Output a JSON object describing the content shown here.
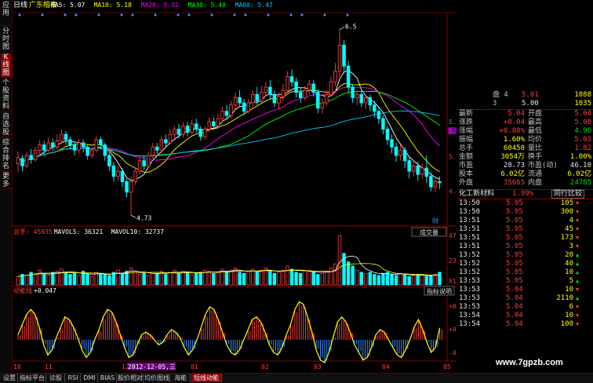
{
  "sidetabs": [
    "应用",
    "分时图",
    "K线图",
    "个股资料",
    "自选股",
    "综合排名",
    "更多"
  ],
  "header": {
    "period": "日线",
    "stock": "广东榕泰",
    "ma": [
      {
        "label": "MA5: 5.07",
        "color": "#ffffff"
      },
      {
        "label": "MA10: 5.18",
        "color": "#ffff00"
      },
      {
        "label": "MA20: 5.32",
        "color": "#ff00ff"
      },
      {
        "label": "MA30: 5.40",
        "color": "#00ff00"
      },
      {
        "label": "MA60: 5.47",
        "color": "#00c8ff"
      }
    ]
  },
  "price_axis": [
    "5.62",
    "5.53",
    "5.29",
    "4.96"
  ],
  "price_marks": {
    "high": "6.5",
    "low": "4.73"
  },
  "vol_header": {
    "items": [
      {
        "label": "总手: 45935",
        "color": "#ff3c3c"
      },
      {
        "label": "MAVOL5: 36321",
        "color": "#ffffff"
      },
      {
        "label": "MAVOL10: 32737",
        "color": "#ffffff"
      }
    ],
    "select": "成交量",
    "fin_icon": "财"
  },
  "vol_axis": [
    "47368",
    "23684",
    "X10"
  ],
  "ind_header": {
    "name": "动能线",
    "value": "+0.047",
    "button": "指标说明"
  },
  "ind_axis": [
    "+0.133",
    "+0.041",
    "-0.051"
  ],
  "x_axis": [
    "10",
    "11",
    "12",
    "2012-12-05,三",
    "01",
    "02",
    "03",
    "04",
    "05"
  ],
  "chart_data": {
    "type": "candlestick",
    "price_range": [
      4.73,
      6.5
    ],
    "candles": [
      [
        5.22,
        5.28,
        5.34,
        5.14
      ],
      [
        5.27,
        5.2,
        5.3,
        5.15
      ],
      [
        5.2,
        5.3,
        5.33,
        5.18
      ],
      [
        5.3,
        5.26,
        5.36,
        5.22
      ],
      [
        5.26,
        5.35,
        5.38,
        5.24
      ],
      [
        5.35,
        5.4,
        5.45,
        5.31
      ],
      [
        5.4,
        5.35,
        5.44,
        5.3
      ],
      [
        5.35,
        5.42,
        5.47,
        5.33
      ],
      [
        5.42,
        5.38,
        5.46,
        5.34
      ],
      [
        5.38,
        5.44,
        5.5,
        5.35
      ],
      [
        5.44,
        5.5,
        5.55,
        5.41
      ],
      [
        5.5,
        5.45,
        5.53,
        5.4
      ],
      [
        5.45,
        5.4,
        5.48,
        5.36
      ],
      [
        5.4,
        5.35,
        5.43,
        5.3
      ],
      [
        5.35,
        5.42,
        5.46,
        5.32
      ],
      [
        5.42,
        5.38,
        5.45,
        5.33
      ],
      [
        5.38,
        5.3,
        5.4,
        5.26
      ],
      [
        5.3,
        5.35,
        5.38,
        5.27
      ],
      [
        5.35,
        5.45,
        5.48,
        5.33
      ],
      [
        5.45,
        5.4,
        5.48,
        5.36
      ],
      [
        5.4,
        5.3,
        5.42,
        5.25
      ],
      [
        5.3,
        5.2,
        5.33,
        5.15
      ],
      [
        5.2,
        5.1,
        5.24,
        5.05
      ],
      [
        5.1,
        5.15,
        5.2,
        5.06
      ],
      [
        5.15,
        5.05,
        5.18,
        5.0
      ],
      [
        5.05,
        4.95,
        5.08,
        4.9
      ],
      [
        4.95,
        5.05,
        5.1,
        4.73
      ],
      [
        5.05,
        5.15,
        5.18,
        5.02
      ],
      [
        5.15,
        5.25,
        5.28,
        5.12
      ],
      [
        5.25,
        5.2,
        5.3,
        5.16
      ],
      [
        5.2,
        5.3,
        5.33,
        5.18
      ],
      [
        5.3,
        5.38,
        5.42,
        5.27
      ],
      [
        5.38,
        5.35,
        5.42,
        5.31
      ],
      [
        5.35,
        5.45,
        5.48,
        5.33
      ],
      [
        5.45,
        5.42,
        5.5,
        5.38
      ],
      [
        5.42,
        5.5,
        5.55,
        5.4
      ],
      [
        5.5,
        5.55,
        5.58,
        5.46
      ],
      [
        5.55,
        5.5,
        5.6,
        5.46
      ],
      [
        5.5,
        5.58,
        5.62,
        5.47
      ],
      [
        5.58,
        5.52,
        5.62,
        5.48
      ],
      [
        5.52,
        5.6,
        5.64,
        5.5
      ],
      [
        5.6,
        5.55,
        5.65,
        5.51
      ],
      [
        5.55,
        5.48,
        5.58,
        5.44
      ],
      [
        5.48,
        5.55,
        5.58,
        5.45
      ],
      [
        5.55,
        5.62,
        5.66,
        5.52
      ],
      [
        5.62,
        5.58,
        5.66,
        5.54
      ],
      [
        5.58,
        5.65,
        5.7,
        5.56
      ],
      [
        5.65,
        5.72,
        5.76,
        5.62
      ],
      [
        5.72,
        5.68,
        5.78,
        5.64
      ],
      [
        5.68,
        5.78,
        5.82,
        5.65
      ],
      [
        5.78,
        5.85,
        5.9,
        5.74
      ],
      [
        5.85,
        5.8,
        5.92,
        5.76
      ],
      [
        5.8,
        5.72,
        5.84,
        5.68
      ],
      [
        5.72,
        5.8,
        5.84,
        5.7
      ],
      [
        5.8,
        5.88,
        5.92,
        5.76
      ],
      [
        5.88,
        5.82,
        5.95,
        5.78
      ],
      [
        5.82,
        5.9,
        5.96,
        5.8
      ],
      [
        5.9,
        5.95,
        6.0,
        5.86
      ],
      [
        5.95,
        5.88,
        6.02,
        5.84
      ],
      [
        5.88,
        5.8,
        5.92,
        5.76
      ],
      [
        5.8,
        5.86,
        5.9,
        5.74
      ],
      [
        5.86,
        5.92,
        5.98,
        5.82
      ],
      [
        5.92,
        6.05,
        6.1,
        5.9
      ],
      [
        6.05,
        6.0,
        6.12,
        5.95
      ],
      [
        6.0,
        5.9,
        6.04,
        5.85
      ],
      [
        5.9,
        5.85,
        5.95,
        5.8
      ],
      [
        5.85,
        5.92,
        5.96,
        5.82
      ],
      [
        5.92,
        5.98,
        6.02,
        5.88
      ],
      [
        5.98,
        5.9,
        6.02,
        5.86
      ],
      [
        5.9,
        5.75,
        5.93,
        5.7
      ],
      [
        5.75,
        5.8,
        5.84,
        5.7
      ],
      [
        5.8,
        5.88,
        5.92,
        5.77
      ],
      [
        5.88,
        6.0,
        6.05,
        5.86
      ],
      [
        6.0,
        6.1,
        6.18,
        5.96
      ],
      [
        6.1,
        6.35,
        6.5,
        6.05
      ],
      [
        6.35,
        6.15,
        6.4,
        6.08
      ],
      [
        6.15,
        5.95,
        6.2,
        5.9
      ],
      [
        5.95,
        5.85,
        5.98,
        5.8
      ],
      [
        5.85,
        5.88,
        5.92,
        5.78
      ],
      [
        5.88,
        5.8,
        5.92,
        5.76
      ],
      [
        5.8,
        5.85,
        5.88,
        5.74
      ],
      [
        5.85,
        5.78,
        5.88,
        5.72
      ],
      [
        5.78,
        5.72,
        5.82,
        5.66
      ],
      [
        5.72,
        5.65,
        5.75,
        5.6
      ],
      [
        5.65,
        5.55,
        5.68,
        5.5
      ],
      [
        5.55,
        5.45,
        5.58,
        5.4
      ],
      [
        5.45,
        5.38,
        5.5,
        5.32
      ],
      [
        5.38,
        5.3,
        5.42,
        5.24
      ],
      [
        5.3,
        5.35,
        5.4,
        5.25
      ],
      [
        5.35,
        5.25,
        5.38,
        5.18
      ],
      [
        5.25,
        5.15,
        5.28,
        5.08
      ],
      [
        5.15,
        5.2,
        5.26,
        5.1
      ],
      [
        5.2,
        5.12,
        5.24,
        5.06
      ],
      [
        5.12,
        5.18,
        5.22,
        5.08
      ],
      [
        5.18,
        5.1,
        5.3,
        5.04
      ],
      [
        5.1,
        5.0,
        5.14,
        4.96
      ],
      [
        5.0,
        5.05,
        5.08,
        4.95
      ],
      [
        5.05,
        5.04,
        5.1,
        4.98
      ]
    ],
    "ma5_last": 5.07,
    "ma10_last": 5.18,
    "ma20_last": 5.32,
    "ma30_last": 5.4,
    "ma60_last": 5.47,
    "volume_range": [
      0,
      47368
    ],
    "volumes": [
      8,
      10,
      9,
      12,
      11,
      14,
      10,
      9,
      12,
      13,
      15,
      12,
      10,
      11,
      9,
      13,
      10,
      8,
      12,
      11,
      10,
      9,
      12,
      14,
      11,
      13,
      16,
      12,
      10,
      11,
      9,
      12,
      11,
      13,
      10,
      12,
      14,
      11,
      13,
      12,
      10,
      11,
      12,
      14,
      13,
      11,
      12,
      15,
      13,
      14,
      16,
      12,
      11,
      13,
      15,
      12,
      14,
      16,
      13,
      11,
      12,
      14,
      18,
      15,
      12,
      11,
      13,
      14,
      12,
      10,
      11,
      13,
      16,
      20,
      47,
      30,
      22,
      18,
      14,
      12,
      11,
      12,
      10,
      9,
      11,
      12,
      10,
      9,
      11,
      10,
      8,
      9,
      10,
      9,
      8,
      9,
      10,
      12
    ],
    "indicator": {
      "name": "动能线",
      "last": 0.047,
      "range": [
        -0.09,
        0.17
      ],
      "values": [
        0.02,
        0.06,
        0.1,
        0.12,
        0.1,
        0.05,
        -0.02,
        -0.06,
        -0.04,
        0.01,
        0.05,
        0.09,
        0.08,
        0.05,
        0.01,
        -0.04,
        -0.07,
        -0.05,
        0.0,
        0.04,
        0.09,
        0.12,
        0.11,
        0.07,
        0.02,
        -0.03,
        -0.07,
        -0.06,
        -0.02,
        0.02,
        0.03,
        0.02,
        0.0,
        -0.02,
        -0.01,
        0.02,
        0.04,
        0.03,
        0.01,
        -0.03,
        -0.06,
        -0.04,
        0.0,
        0.05,
        0.1,
        0.13,
        0.12,
        0.08,
        0.03,
        -0.02,
        -0.05,
        -0.06,
        -0.04,
        0.0,
        0.04,
        0.08,
        0.09,
        0.07,
        0.03,
        -0.02,
        -0.05,
        -0.06,
        -0.03,
        0.02,
        0.06,
        0.12,
        0.15,
        0.14,
        0.09,
        0.03,
        -0.04,
        -0.08,
        -0.09,
        -0.05,
        0.01,
        0.07,
        0.09,
        0.07,
        0.03,
        -0.02,
        -0.05,
        -0.08,
        -0.07,
        -0.03,
        0.02,
        0.04,
        0.03,
        0.0,
        -0.03,
        -0.06,
        -0.07,
        -0.04,
        0.0,
        0.05,
        0.08,
        0.04,
        -0.01,
        -0.05,
        -0.03,
        0.047
      ]
    }
  },
  "quote": {
    "order_rows": [
      {
        "label": "盘 4",
        "price": "5.01",
        "vol": "1088"
      },
      {
        "label": "3",
        "price": "5.00",
        "vol": "1035"
      }
    ],
    "stats": [
      {
        "l1": "最新",
        "v1": "5.04",
        "c1": "red",
        "l2": "开盘",
        "v2": "5.04",
        "c2": "red"
      },
      {
        "l1": "涨跌",
        "v1": "+0.04",
        "c1": "red",
        "l2": "最高",
        "v2": "5.08",
        "c2": "red"
      },
      {
        "l1": "涨幅",
        "v1": "+0.80%",
        "c1": "red",
        "l2": "最低",
        "v2": "4.96",
        "c2": "grn"
      },
      {
        "l1": "振幅",
        "v1": "1.60%",
        "c1": "yel",
        "l2": "均价",
        "v2": "5.03",
        "c2": "red"
      },
      {
        "l1": "总手",
        "v1": "60450",
        "c1": "yel",
        "l2": "量比",
        "v2": "1.82",
        "c2": "red"
      },
      {
        "l1": "金额",
        "v1": "3054万",
        "c1": "yel",
        "l2": "换手",
        "v2": "1.00%",
        "c2": "yel"
      },
      {
        "l1": "市盈",
        "v1": "28.73",
        "c1": "wht",
        "l2": "市盈(动)",
        "v2": "46.10",
        "c2": "wht"
      },
      {
        "l1": "股本",
        "v1": "6.02亿",
        "c1": "yel",
        "l2": "流通",
        "v2": "6.02亿",
        "c2": "yel"
      },
      {
        "l1": "外盘",
        "v1": "35665",
        "c1": "red",
        "l2": "内盘",
        "v2": "24785",
        "c2": "grn"
      }
    ],
    "industry": {
      "name": "化工新材料",
      "pct": "1.99%",
      "button": "同行比较"
    },
    "ticks": [
      {
        "t": "13:50",
        "p": "5.05",
        "v": "105",
        "d": "down"
      },
      {
        "t": "13:50",
        "p": "5.05",
        "v": "300",
        "d": "down"
      },
      {
        "t": "13:51",
        "p": "5.05",
        "v": "4",
        "d": "down"
      },
      {
        "t": "13:51",
        "p": "5.05",
        "v": "45",
        "d": "down"
      },
      {
        "t": "13:51",
        "p": "5.05",
        "v": "173",
        "d": "down"
      },
      {
        "t": "13:51",
        "p": "5.05",
        "v": "3",
        "d": "down"
      },
      {
        "t": "13:52",
        "p": "5.05",
        "v": "20",
        "d": "up"
      },
      {
        "t": "13:52",
        "p": "5.05",
        "v": "40",
        "d": "up"
      },
      {
        "t": "13:52",
        "p": "5.05",
        "v": "10",
        "d": "up"
      },
      {
        "t": "13:53",
        "p": "5.05",
        "v": "5",
        "d": "up"
      },
      {
        "t": "13:53",
        "p": "5.04",
        "v": "10",
        "d": "down"
      },
      {
        "t": "13:53",
        "p": "5.04",
        "v": "2110",
        "d": "up"
      },
      {
        "t": "13:53",
        "p": "5.04",
        "v": "6",
        "d": "down"
      },
      {
        "t": "13:54",
        "p": "5.04",
        "v": "10",
        "d": "down"
      },
      {
        "t": "13:54",
        "p": "5.04",
        "v": "100",
        "d": "down"
      }
    ]
  },
  "bottom_tabs": [
    "设置",
    "指标平台",
    "诊股",
    "RSI",
    "DMI",
    "BIAS",
    "股价相对",
    "均价图线",
    "海能",
    "短线动能"
  ],
  "active_bottom_tab": "短线动能",
  "watermark": "www.7gpzb.com",
  "colors": {
    "up": "#ff3c3c",
    "down": "#00ffff",
    "ma5": "#ffffff",
    "ma10": "#ffff00",
    "ma20": "#ff00ff",
    "ma30": "#00ff00",
    "ma60": "#00c8ff"
  }
}
